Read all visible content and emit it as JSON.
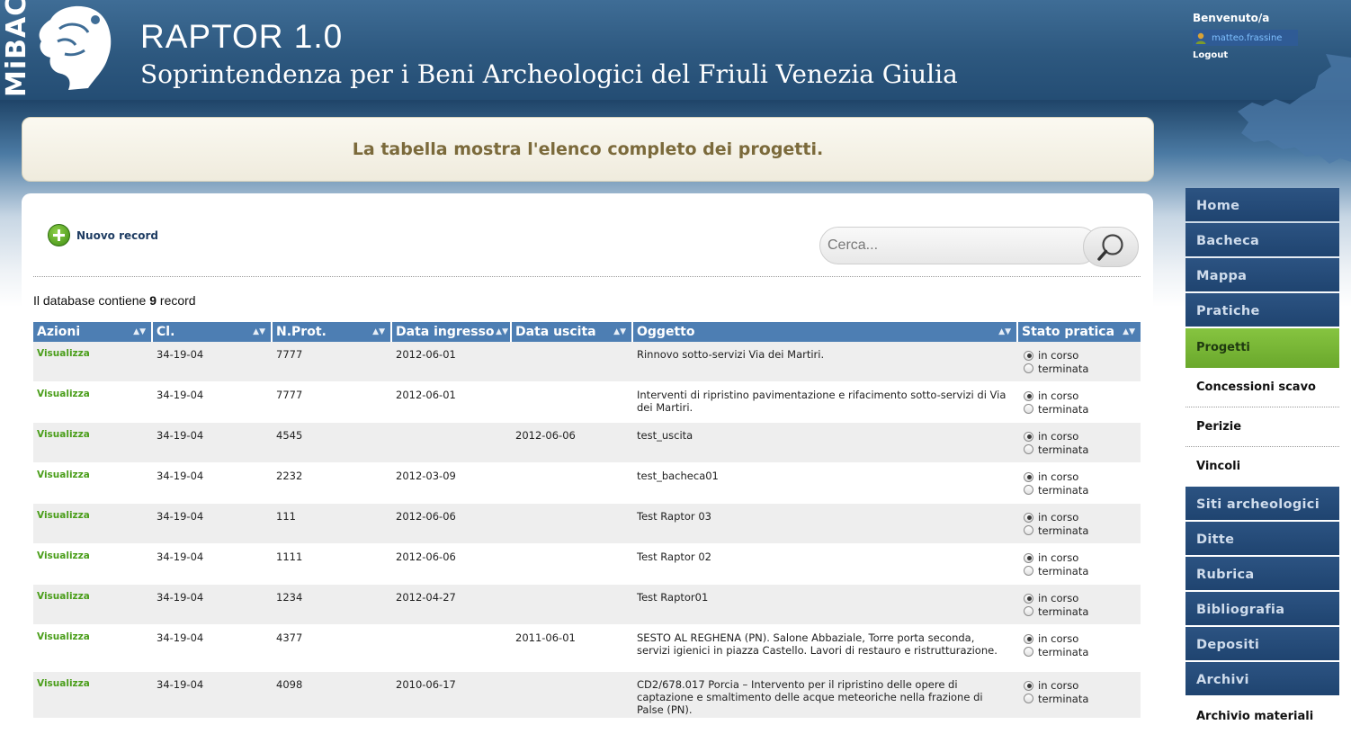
{
  "header": {
    "logo_text": "MiBAC",
    "app_title": "RAPTOR 1.0",
    "org_title": "Soprintendenza per i Beni Archeologici del Friuli Venezia Giulia",
    "welcome": "Benvenuto/a",
    "username": "matteo.frassine",
    "logout": "Logout"
  },
  "banner": {
    "message": "La tabella mostra l'elenco completo dei progetti."
  },
  "toolbar": {
    "new_record": "Nuovo record",
    "search_placeholder": "Cerca..."
  },
  "db_info": {
    "prefix": "Il database contiene",
    "count": "9",
    "suffix": "record"
  },
  "table": {
    "columns": [
      "Azioni",
      "Cl.",
      "N.Prot.",
      "Data ingresso",
      "Data uscita",
      "Oggetto",
      "Stato pratica"
    ],
    "status_options": [
      "in corso",
      "terminata"
    ],
    "rows": [
      {
        "action": "Visualizza",
        "cl": "34-19-04",
        "prot": "7777",
        "ingresso": "2012-06-01",
        "uscita": "",
        "oggetto": "Rinnovo sotto-servizi Via dei Martiri.",
        "stato": "in corso"
      },
      {
        "action": "Visualizza",
        "cl": "34-19-04",
        "prot": "7777",
        "ingresso": "2012-06-01",
        "uscita": "",
        "oggetto": "Interventi di ripristino pavimentazione e rifacimento sotto-servizi di Via dei Martiri.",
        "stato": "in corso"
      },
      {
        "action": "Visualizza",
        "cl": "34-19-04",
        "prot": "4545",
        "ingresso": "",
        "uscita": "2012-06-06",
        "oggetto": "test_uscita",
        "stato": "in corso"
      },
      {
        "action": "Visualizza",
        "cl": "34-19-04",
        "prot": "2232",
        "ingresso": "2012-03-09",
        "uscita": "",
        "oggetto": "test_bacheca01",
        "stato": "in corso"
      },
      {
        "action": "Visualizza",
        "cl": "34-19-04",
        "prot": "111",
        "ingresso": "2012-06-06",
        "uscita": "",
        "oggetto": "Test Raptor 03",
        "stato": "in corso"
      },
      {
        "action": "Visualizza",
        "cl": "34-19-04",
        "prot": "1111",
        "ingresso": "2012-06-06",
        "uscita": "",
        "oggetto": "Test Raptor 02",
        "stato": "in corso"
      },
      {
        "action": "Visualizza",
        "cl": "34-19-04",
        "prot": "1234",
        "ingresso": "2012-04-27",
        "uscita": "",
        "oggetto": "Test Raptor01",
        "stato": "in corso"
      },
      {
        "action": "Visualizza",
        "cl": "34-19-04",
        "prot": "4377",
        "ingresso": "",
        "uscita": "2011-06-01",
        "oggetto": "SESTO AL REGHENA (PN). Salone Abbaziale, Torre porta seconda, servizi igienici in piazza Castello. Lavori di restauro e ristrutturazione.",
        "stato": "in corso"
      },
      {
        "action": "Visualizza",
        "cl": "34-19-04",
        "prot": "4098",
        "ingresso": "2010-06-17",
        "uscita": "",
        "oggetto": "CD2/678.017 Porcia – Intervento per il ripristino delle opere di captazione e smaltimento delle acque meteoriche nella frazione di Palse (PN).",
        "stato": "in corso"
      }
    ]
  },
  "sidenav": {
    "items": [
      {
        "label": "Home",
        "type": "main"
      },
      {
        "label": "Bacheca",
        "type": "main"
      },
      {
        "label": "Mappa",
        "type": "main"
      },
      {
        "label": "Pratiche",
        "type": "main"
      },
      {
        "label": "Progetti",
        "type": "sub",
        "active": true
      },
      {
        "label": "Concessioni scavo",
        "type": "sub"
      },
      {
        "label": "Perizie",
        "type": "sub"
      },
      {
        "label": "Vincoli",
        "type": "sub"
      },
      {
        "label": "Siti archeologici",
        "type": "main"
      },
      {
        "label": "Ditte",
        "type": "main"
      },
      {
        "label": "Rubrica",
        "type": "main"
      },
      {
        "label": "Bibliografia",
        "type": "main"
      },
      {
        "label": "Depositi",
        "type": "main"
      },
      {
        "label": "Archivi",
        "type": "main"
      },
      {
        "label": "Archivio materiali",
        "type": "sub"
      }
    ]
  },
  "colors": {
    "header": "#2d587f",
    "table_header": "#4d7eb3",
    "nav": "#244b78",
    "nav_active": "#7ab836",
    "link": "#4a9e1a",
    "banner_text": "#7b6a3b"
  },
  "icons": {
    "logo": "statue-head-logo",
    "user": "user-icon",
    "new_record": "plus-circle-icon",
    "search": "magnifier-icon",
    "sort": "sort-arrows-icon",
    "region": "region-map-icon"
  }
}
